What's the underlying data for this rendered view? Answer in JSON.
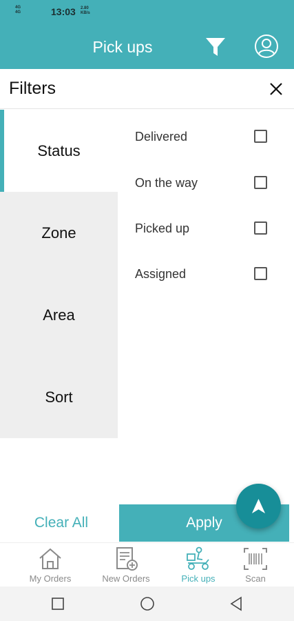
{
  "status_bar": {
    "network_top": "4G",
    "network_bottom": "4G",
    "time": "13:03",
    "speed_value": "2.80",
    "speed_unit": "KB/s"
  },
  "header": {
    "title": "Pick ups",
    "filter_icon": "filter-funnel-icon",
    "profile_icon": "user-circle-icon"
  },
  "filters": {
    "heading": "Filters",
    "close_icon": "close-icon"
  },
  "tabs": [
    {
      "label": "Status",
      "active": true
    },
    {
      "label": "Zone",
      "active": false
    },
    {
      "label": "Area",
      "active": false
    },
    {
      "label": "Sort",
      "active": false
    }
  ],
  "options": [
    {
      "label": "Delivered",
      "checked": false
    },
    {
      "label": "On the way",
      "checked": false
    },
    {
      "label": "Picked up",
      "checked": false
    },
    {
      "label": "Assigned",
      "checked": false
    }
  ],
  "actions": {
    "clear_all": "Clear All",
    "apply": "Apply"
  },
  "fab_icon": "navigation-arrow-icon",
  "bottom_nav": [
    {
      "label": "My Orders",
      "icon": "home-icon",
      "active": false
    },
    {
      "label": "New Orders",
      "icon": "new-order-document-icon",
      "active": false
    },
    {
      "label": "Pick ups",
      "icon": "delivery-scooter-icon",
      "active": true
    },
    {
      "label": "Scan",
      "icon": "barcode-scan-icon",
      "active": false
    }
  ],
  "colors": {
    "primary": "#44b0b8",
    "fab": "#178e98",
    "tab_background": "#eeeeee"
  }
}
